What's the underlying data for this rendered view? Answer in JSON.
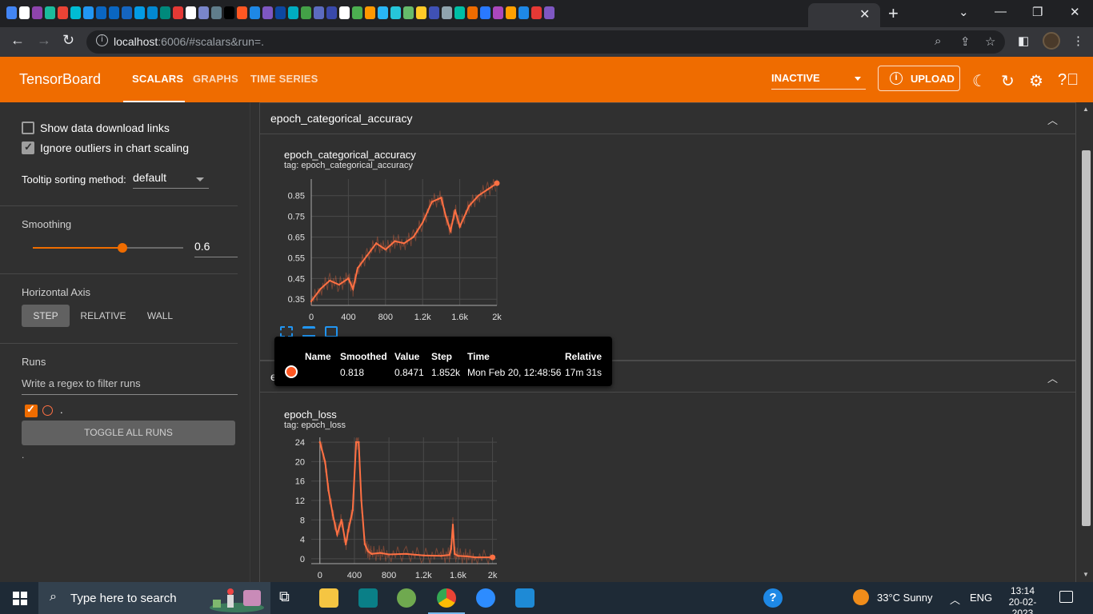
{
  "browser": {
    "url_host": "localhost",
    "url_rest": ":6006/#scalars&run=."
  },
  "header": {
    "brand": "TensorBoard",
    "tabs": [
      "SCALARS",
      "GRAPHS",
      "TIME SERIES"
    ],
    "active_tab": "SCALARS",
    "run_status": "INACTIVE",
    "upload_label": "UPLOAD"
  },
  "sidebar": {
    "show_download_links": "Show data download links",
    "ignore_outliers": "Ignore outliers in chart scaling",
    "tooltip_sort_label": "Tooltip sorting method:",
    "tooltip_sort_value": "default",
    "smoothing_label": "Smoothing",
    "smoothing_value": "0.6",
    "horizontal_axis_label": "Horizontal Axis",
    "axis_options": [
      "STEP",
      "RELATIVE",
      "WALL"
    ],
    "runs_label": "Runs",
    "runs_filter_placeholder": "Write a regex to filter runs",
    "run_name": ".",
    "toggle_all_runs": "TOGGLE ALL RUNS",
    "footer_dot": "."
  },
  "groups": [
    {
      "title": "epoch_categorical_accuracy",
      "card_title": "epoch_categorical_accuracy",
      "card_tag": "tag: epoch_categorical_accuracy"
    },
    {
      "title": "epoch_loss",
      "card_title": "epoch_loss",
      "card_tag": "tag: epoch_loss"
    }
  ],
  "tooltip": {
    "headers": [
      "Name",
      "Smoothed",
      "Value",
      "Step",
      "Time",
      "Relative"
    ],
    "row": {
      "name": "",
      "smoothed": "0.818",
      "value": "0.8471",
      "step": "1.852k",
      "time": "Mon Feb 20, 12:48:56",
      "relative": "17m 31s"
    }
  },
  "chart_data": [
    {
      "type": "line",
      "title": "epoch_categorical_accuracy",
      "xlabel": "",
      "ylabel": "",
      "x_ticks": [
        "0",
        "400",
        "800",
        "1.2k",
        "1.6k",
        "2k"
      ],
      "y_ticks": [
        "0.35",
        "0.45",
        "0.55",
        "0.65",
        "0.75",
        "0.85"
      ],
      "xlim": [
        0,
        2000
      ],
      "ylim": [
        0.32,
        0.93
      ],
      "series": [
        {
          "color": "#ff7043",
          "x": [
            0,
            100,
            200,
            300,
            400,
            450,
            500,
            600,
            700,
            800,
            900,
            1000,
            1100,
            1200,
            1300,
            1400,
            1450,
            1500,
            1550,
            1600,
            1700,
            1800,
            1900,
            2000
          ],
          "y": [
            0.34,
            0.4,
            0.44,
            0.42,
            0.45,
            0.4,
            0.5,
            0.56,
            0.62,
            0.59,
            0.63,
            0.62,
            0.65,
            0.72,
            0.82,
            0.84,
            0.75,
            0.68,
            0.78,
            0.7,
            0.8,
            0.85,
            0.88,
            0.91
          ]
        }
      ]
    },
    {
      "type": "line",
      "title": "epoch_loss",
      "xlabel": "",
      "ylabel": "",
      "x_ticks": [
        "0",
        "400",
        "800",
        "1.2k",
        "1.6k",
        "2k"
      ],
      "y_ticks": [
        "0",
        "4",
        "8",
        "12",
        "16",
        "20",
        "24"
      ],
      "xlim": [
        -100,
        2050
      ],
      "ylim": [
        -1,
        25
      ],
      "series": [
        {
          "color": "#ff7043",
          "x": [
            0,
            60,
            100,
            150,
            200,
            250,
            300,
            330,
            380,
            420,
            450,
            480,
            520,
            560,
            600,
            700,
            800,
            1000,
            1200,
            1400,
            1500,
            1520,
            1540,
            1560,
            1600,
            1700,
            1800,
            2000
          ],
          "y": [
            24,
            20,
            14,
            9,
            5,
            8,
            3,
            6,
            10,
            24,
            24,
            12,
            3,
            1.5,
            1.0,
            1.2,
            0.9,
            1.0,
            0.7,
            0.6,
            0.8,
            2,
            7,
            1,
            0.6,
            0.5,
            0.3,
            0.3
          ]
        }
      ]
    }
  ]
}
